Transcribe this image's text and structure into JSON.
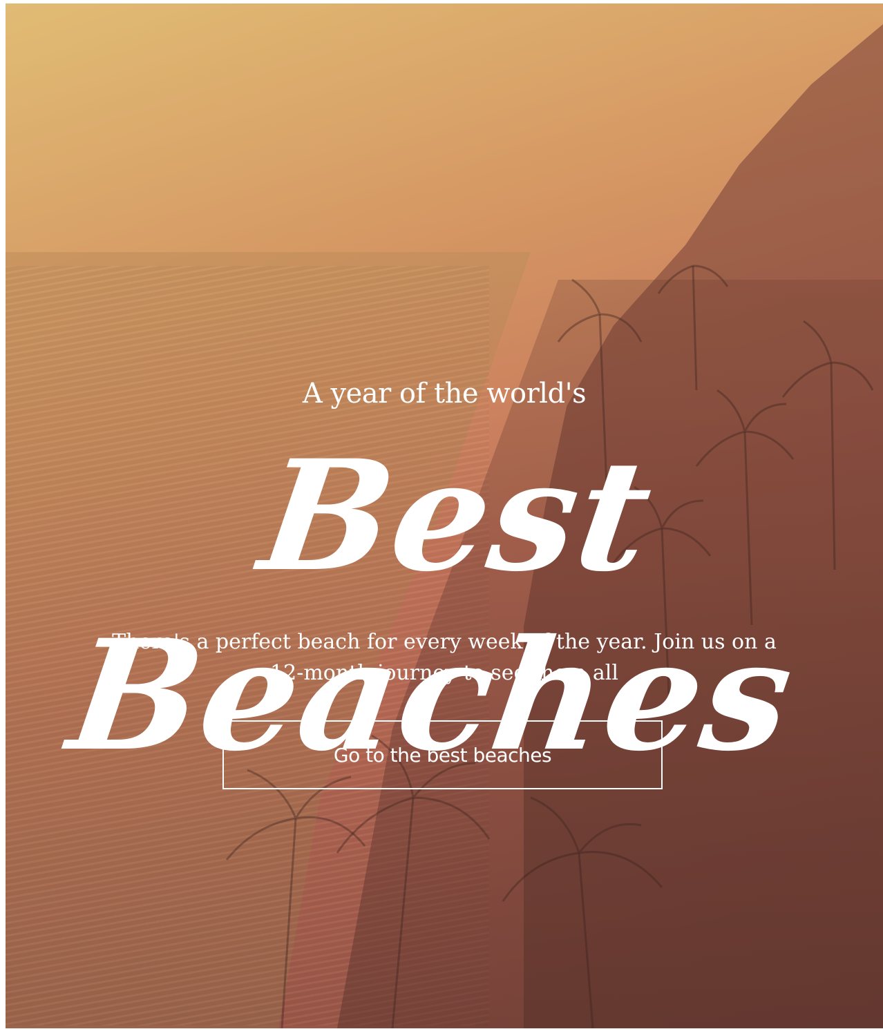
{
  "hero": {
    "subtitle": "A year of the world's",
    "title": "Best Beaches",
    "description": "There's a perfect beach for every week of the year. Join us on a 12-month journey to see them all",
    "cta_label": "Go to the best beaches",
    "background_image": "aerial-coastline-palm-trees-photo",
    "overlay_colors": [
      "#e2c076",
      "#d69662",
      "#c46e5a",
      "#965046"
    ]
  }
}
